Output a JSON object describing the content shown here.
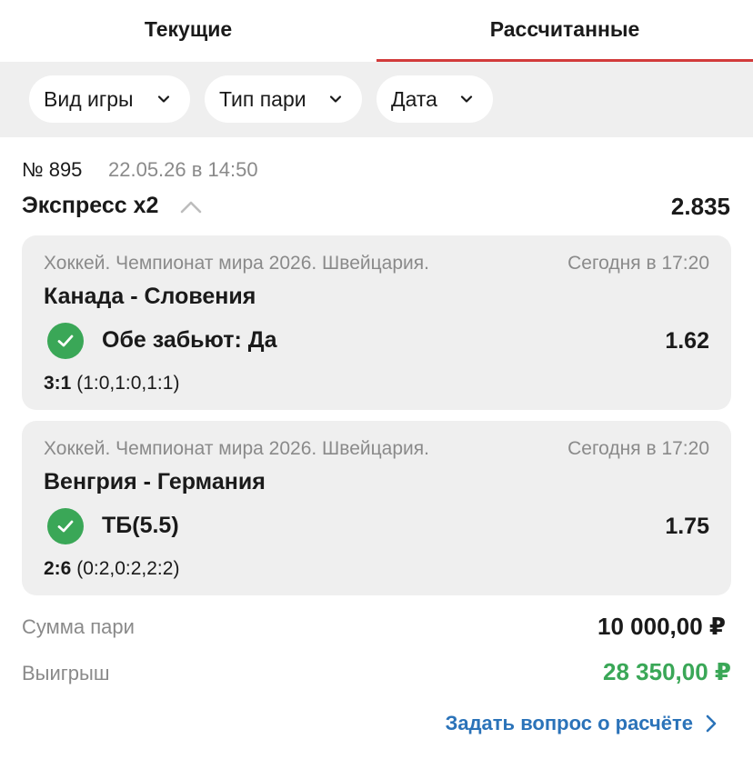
{
  "tabs": [
    {
      "label": "Текущие",
      "active": false
    },
    {
      "label": "Рассчитанные",
      "active": true
    }
  ],
  "filters": [
    {
      "label": "Вид игры",
      "icon": "chevron-down-icon"
    },
    {
      "label": "Тип пари",
      "icon": "chevron-down-icon"
    },
    {
      "label": "Дата",
      "icon": "chevron-down-icon"
    }
  ],
  "bet": {
    "number": "№ 895",
    "date": "22.05.26 в 14:50",
    "type": "Экспресс x2",
    "total_odds": "2.835",
    "events": [
      {
        "tournament": "Хоккей. Чемпионат мира 2026. Швейцария.",
        "time": "Сегодня в 17:20",
        "teams": "Канада - Словения",
        "outcome": "Обе забьют: Да",
        "odds": "1.62",
        "score": "3:1",
        "periods": "(1:0,1:0,1:1)",
        "status": "won"
      },
      {
        "tournament": "Хоккей. Чемпионат мира 2026. Швейцария.",
        "time": "Сегодня в 17:20",
        "teams": "Венгрия - Германия",
        "outcome": "ТБ(5.5)",
        "odds": "1.75",
        "score": "2:6",
        "periods": "(0:2,0:2,2:2)",
        "status": "won"
      }
    ],
    "stake_label": "Сумма пари",
    "stake_value": "10 000,00 ₽",
    "win_label": "Выигрыш",
    "win_value": "28 350,00 ₽",
    "ask_link": "Задать вопрос о расчёте"
  },
  "colors": {
    "accent_red": "#d23b3b",
    "success_green": "#3aa757",
    "link_blue": "#2b73b9",
    "muted_gray": "#8a8a8a"
  }
}
